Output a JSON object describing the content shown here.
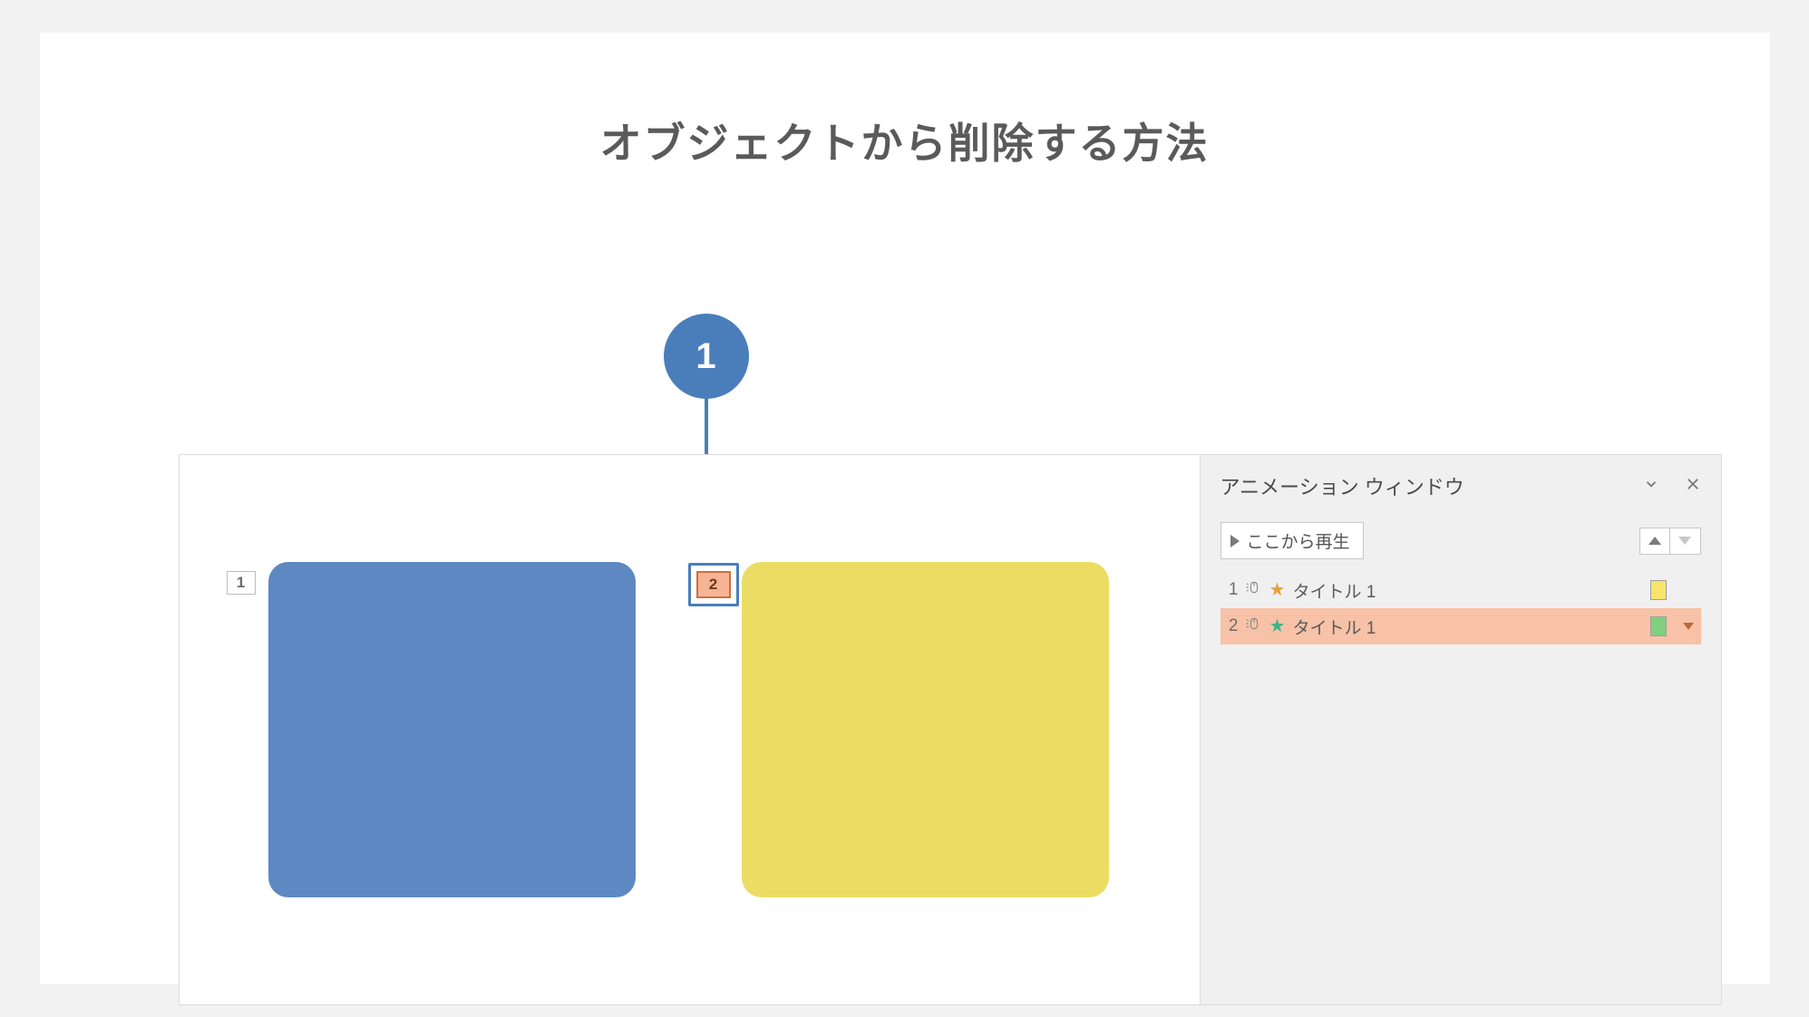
{
  "title": "オブジェクトから削除する方法",
  "callout": {
    "number": "1"
  },
  "slide": {
    "anim_tags": {
      "tag1": "1",
      "tag2": "2"
    }
  },
  "animation_pane": {
    "title": "アニメーション ウィンドウ",
    "play_label": "ここから再生",
    "items": [
      {
        "num": "1",
        "label": "タイトル 1",
        "star_color": "orange",
        "bar_color": "yellow",
        "selected": false
      },
      {
        "num": "2",
        "label": "タイトル 1",
        "star_color": "green",
        "bar_color": "green",
        "selected": true
      }
    ]
  }
}
